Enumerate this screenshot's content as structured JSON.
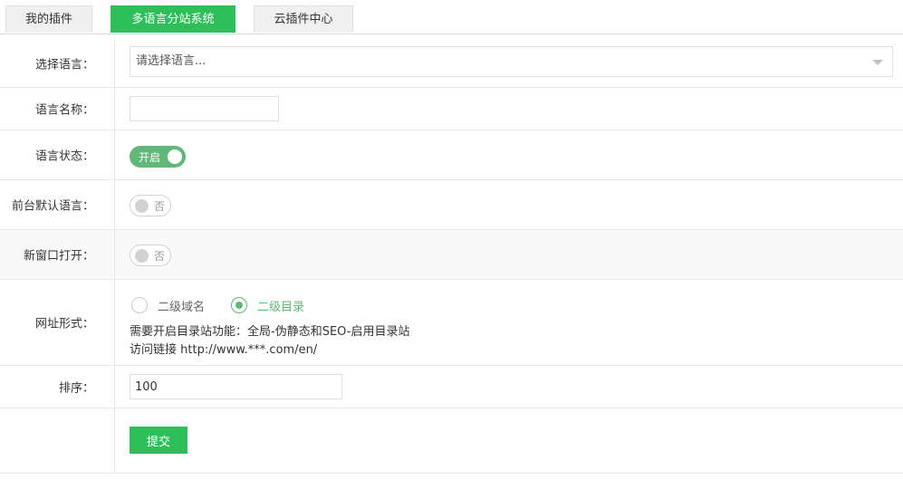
{
  "tabs": [
    {
      "label": "我的插件",
      "active": false
    },
    {
      "label": "多语言分站系统",
      "active": true
    },
    {
      "label": "云插件中心",
      "active": false
    }
  ],
  "form": {
    "language_select": {
      "label": "选择语言：",
      "placeholder": "请选择语言..."
    },
    "language_name": {
      "label": "语言名称：",
      "value": ""
    },
    "language_status": {
      "label": "语言状态：",
      "switch_text": "开启",
      "on": true
    },
    "default_language": {
      "label": "前台默认语言：",
      "switch_text": "否",
      "on": false
    },
    "new_window": {
      "label": "新窗口打开：",
      "switch_text": "否",
      "on": false
    },
    "url_format": {
      "label": "网址形式：",
      "options": [
        {
          "label": "二级域名",
          "checked": false
        },
        {
          "label": "二级目录",
          "checked": true
        }
      ],
      "hint1": "需要开启目录站功能：全局-伪静态和SEO-启用目录站",
      "hint2": "访问链接 http://www.***.com/en/"
    },
    "sort": {
      "label": "排序：",
      "value": "100"
    },
    "submit_label": "提交"
  },
  "colors": {
    "accent": "#2fbf5a",
    "switch_on": "#5fb878",
    "radio_checked": "#5fb878"
  },
  "icons": {
    "select_arrow": "chevron-down-icon"
  }
}
